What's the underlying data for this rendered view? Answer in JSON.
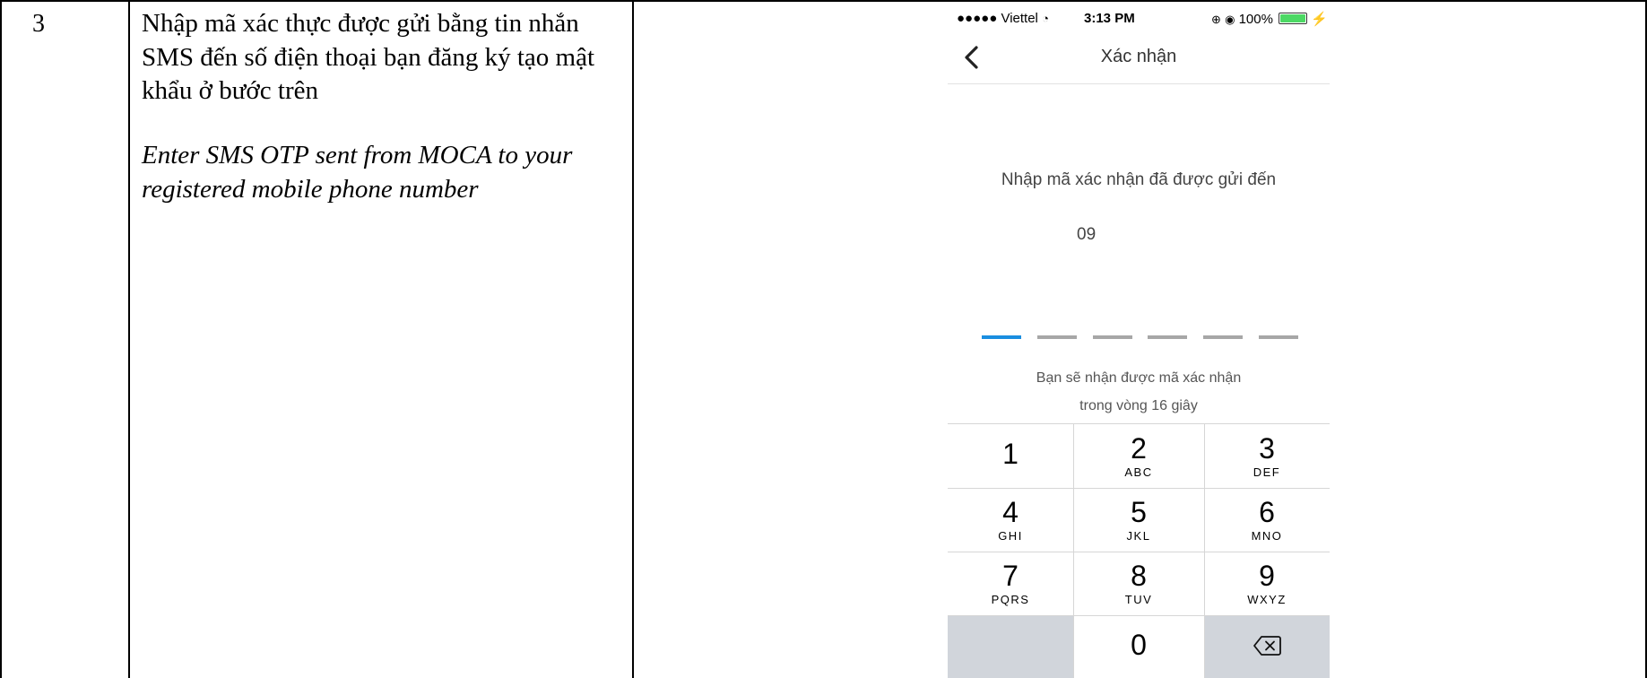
{
  "document": {
    "step_number": "3",
    "description_vi": "Nhập mã xác thực được gửi bằng tin nhắn SMS đến số điện thoại bạn đăng ký tạo mật khẩu ở bước trên",
    "description_en": "Enter SMS OTP sent from MOCA to your registered mobile phone number"
  },
  "phone": {
    "status_bar": {
      "carrier": "●●●●● Viettel",
      "wifi_icon": "wifi-icon",
      "time": "3:13 PM",
      "battery_percent": "100%",
      "battery_level": 1.0,
      "battery_color": "#4cd964"
    },
    "nav": {
      "title": "Xác nhận",
      "back_icon": "chevron-left-icon"
    },
    "prompt": "Nhập mã xác nhận đã được gửi đến",
    "phone_number": "09",
    "otp": {
      "length": 6,
      "filled": 0,
      "active_color": "#1a8ee0",
      "inactive_color": "#a7a7a7"
    },
    "resend_line1": "Bạn sẽ nhận được mã xác nhận",
    "resend_line2": "trong vòng 16 giây",
    "keypad": {
      "k1": {
        "digit": "1",
        "letters": ""
      },
      "k2": {
        "digit": "2",
        "letters": "ABC"
      },
      "k3": {
        "digit": "3",
        "letters": "DEF"
      },
      "k4": {
        "digit": "4",
        "letters": "GHI"
      },
      "k5": {
        "digit": "5",
        "letters": "JKL"
      },
      "k6": {
        "digit": "6",
        "letters": "MNO"
      },
      "k7": {
        "digit": "7",
        "letters": "PQRS"
      },
      "k8": {
        "digit": "8",
        "letters": "TUV"
      },
      "k9": {
        "digit": "9",
        "letters": "WXYZ"
      },
      "k0": {
        "digit": "0",
        "letters": ""
      },
      "delete_icon": "backspace-icon"
    }
  }
}
